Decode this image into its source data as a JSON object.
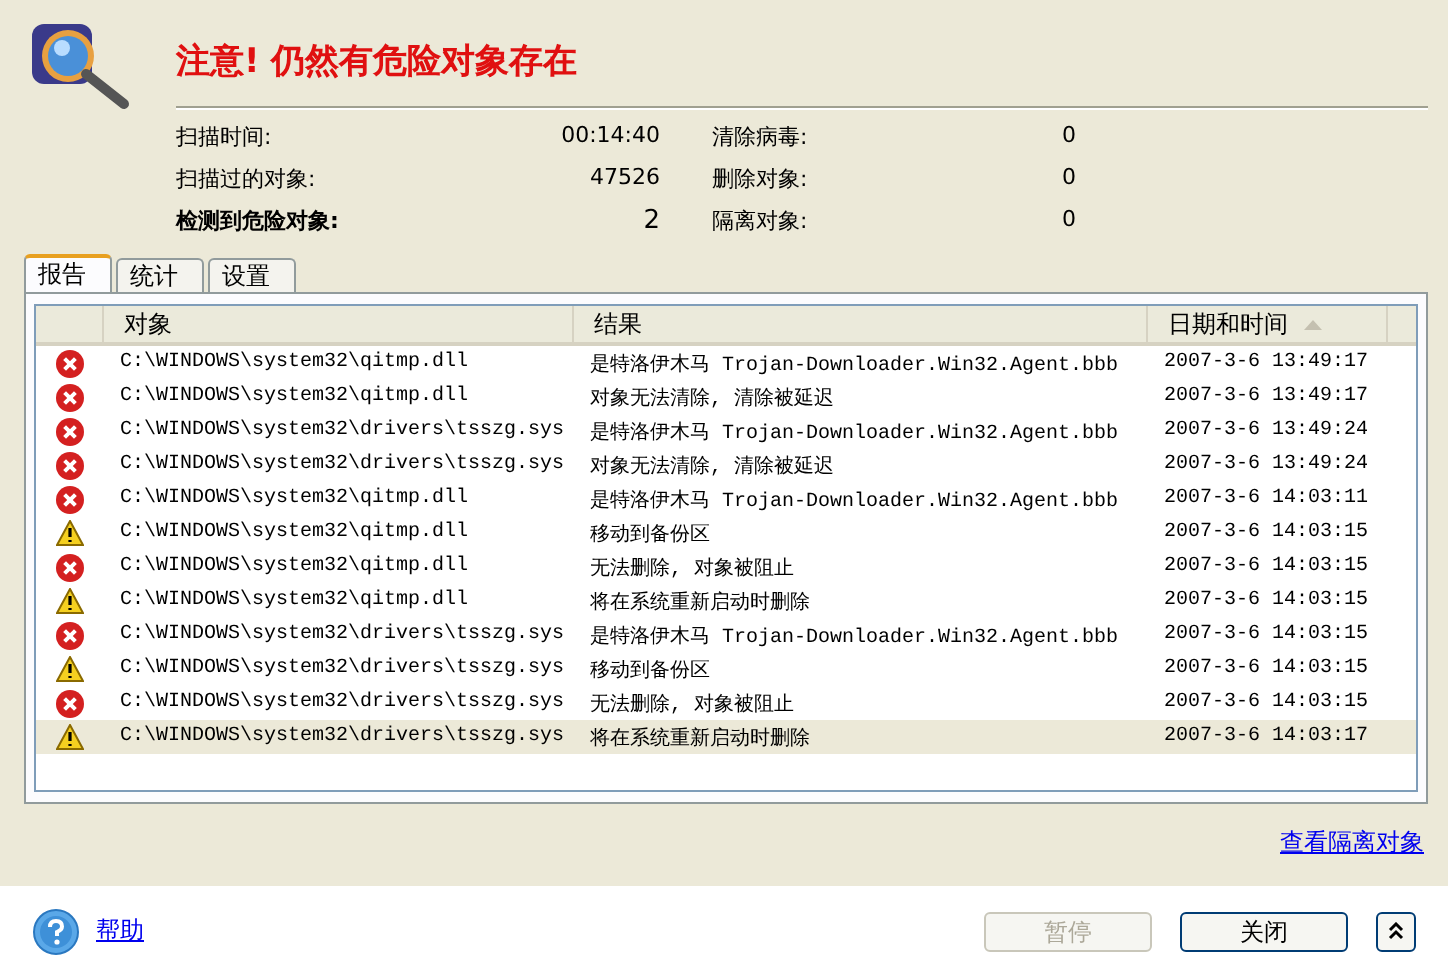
{
  "header": {
    "title": "注意! 仍然有危险对象存在"
  },
  "stats": [
    {
      "label": "扫描时间:",
      "value": "00:14:40",
      "bold": false
    },
    {
      "label": "扫描过的对象:",
      "value": "47526",
      "bold": false
    },
    {
      "label": "检测到危险对象:",
      "value": "2",
      "bold": true
    }
  ],
  "stats_right": [
    {
      "label": "清除病毒:",
      "value": "0"
    },
    {
      "label": "删除对象:",
      "value": "0"
    },
    {
      "label": "隔离对象:",
      "value": "0"
    }
  ],
  "tabs": [
    {
      "label": "报告",
      "selected": true
    },
    {
      "label": "统计",
      "selected": false
    },
    {
      "label": "设置",
      "selected": false
    }
  ],
  "table": {
    "columns": [
      "对象",
      "结果",
      "日期和时间"
    ],
    "rows": [
      {
        "kind": "error",
        "object": "C:\\WINDOWS\\system32\\qitmp.dll",
        "result": "是特洛伊木马 Trojan-Downloader.Win32.Agent.bbb",
        "time": "2007-3-6 13:49:17",
        "selected": false
      },
      {
        "kind": "error",
        "object": "C:\\WINDOWS\\system32\\qitmp.dll",
        "result": "对象无法清除, 清除被延迟",
        "time": "2007-3-6 13:49:17",
        "selected": false
      },
      {
        "kind": "error",
        "object": "C:\\WINDOWS\\system32\\drivers\\tsszg.sys",
        "result": "是特洛伊木马 Trojan-Downloader.Win32.Agent.bbb",
        "time": "2007-3-6 13:49:24",
        "selected": false
      },
      {
        "kind": "error",
        "object": "C:\\WINDOWS\\system32\\drivers\\tsszg.sys",
        "result": "对象无法清除, 清除被延迟",
        "time": "2007-3-6 13:49:24",
        "selected": false
      },
      {
        "kind": "error",
        "object": "C:\\WINDOWS\\system32\\qitmp.dll",
        "result": "是特洛伊木马 Trojan-Downloader.Win32.Agent.bbb",
        "time": "2007-3-6 14:03:11",
        "selected": false
      },
      {
        "kind": "warning",
        "object": "C:\\WINDOWS\\system32\\qitmp.dll",
        "result": "移动到备份区",
        "time": "2007-3-6 14:03:15",
        "selected": false
      },
      {
        "kind": "error",
        "object": "C:\\WINDOWS\\system32\\qitmp.dll",
        "result": "无法删除, 对象被阻止",
        "time": "2007-3-6 14:03:15",
        "selected": false
      },
      {
        "kind": "warning",
        "object": "C:\\WINDOWS\\system32\\qitmp.dll",
        "result": "将在系统重新启动时删除",
        "time": "2007-3-6 14:03:15",
        "selected": false
      },
      {
        "kind": "error",
        "object": "C:\\WINDOWS\\system32\\drivers\\tsszg.sys",
        "result": "是特洛伊木马 Trojan-Downloader.Win32.Agent.bbb",
        "time": "2007-3-6 14:03:15",
        "selected": false
      },
      {
        "kind": "warning",
        "object": "C:\\WINDOWS\\system32\\drivers\\tsszg.sys",
        "result": "移动到备份区",
        "time": "2007-3-6 14:03:15",
        "selected": false
      },
      {
        "kind": "error",
        "object": "C:\\WINDOWS\\system32\\drivers\\tsszg.sys",
        "result": "无法删除, 对象被阻止",
        "time": "2007-3-6 14:03:15",
        "selected": false
      },
      {
        "kind": "warning",
        "object": "C:\\WINDOWS\\system32\\drivers\\tsszg.sys",
        "result": "将在系统重新启动时删除",
        "time": "2007-3-6 14:03:17",
        "selected": true
      }
    ]
  },
  "quarantine_link": "查看隔离对象",
  "footer": {
    "help": "帮助",
    "buttons": [
      {
        "label": "暂停",
        "disabled": true
      },
      {
        "label": "关闭",
        "disabled": false
      }
    ]
  }
}
